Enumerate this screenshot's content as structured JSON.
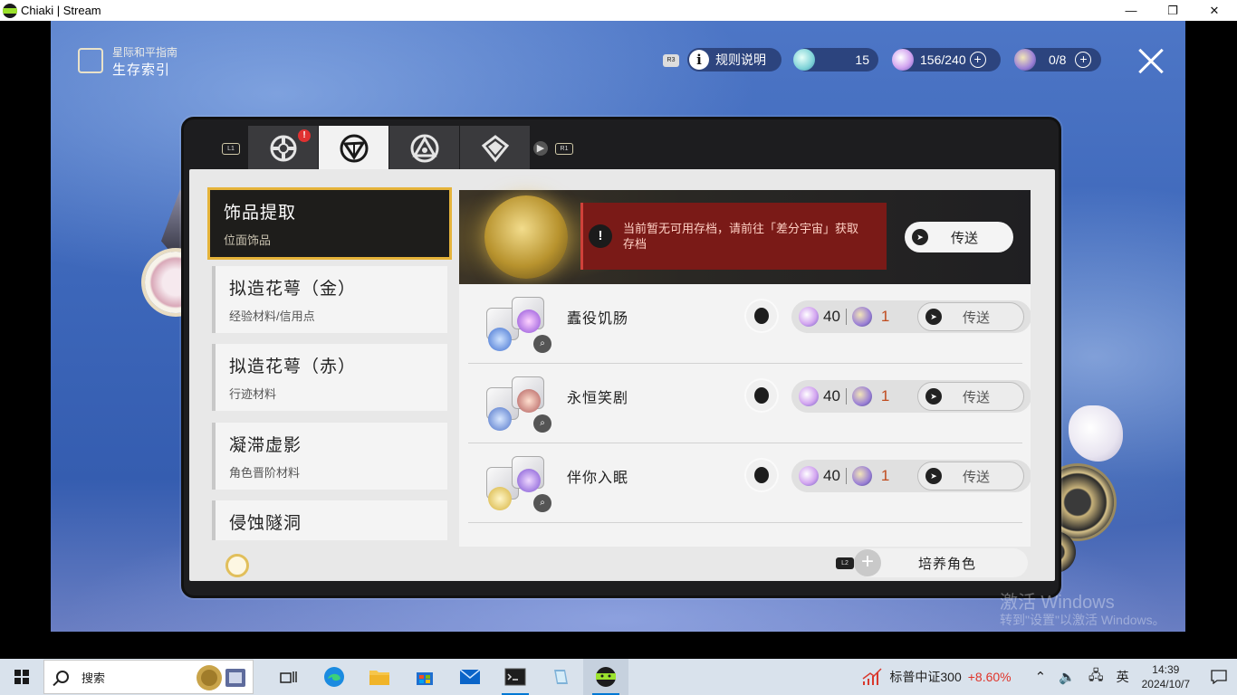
{
  "window": {
    "title": "Chiaki | Stream",
    "controls": {
      "minimize": "—",
      "maximize": "❐",
      "close": "✕"
    }
  },
  "header": {
    "subtitle": "星际和平指南",
    "title": "生存索引",
    "r3_hint": "R3",
    "rules_label": "规则说明",
    "currency_1": "15",
    "currency_2": "156/240",
    "currency_3": "0/8"
  },
  "tabs": {
    "l1_hint": "L1",
    "r1_hint": "R1",
    "badge": "!",
    "items": [
      {
        "name": "tab-1",
        "active": false
      },
      {
        "name": "tab-2",
        "active": true
      },
      {
        "name": "tab-3",
        "active": false
      },
      {
        "name": "tab-4",
        "active": false
      }
    ]
  },
  "sidebar": {
    "items": [
      {
        "title": "饰品提取",
        "subtitle": "位面饰品"
      },
      {
        "title": "拟造花萼（金）",
        "subtitle": "经验材料/信用点"
      },
      {
        "title": "拟造花萼（赤）",
        "subtitle": "行迹材料"
      },
      {
        "title": "凝滞虚影",
        "subtitle": "角色晋阶材料"
      },
      {
        "title": "侵蚀隧洞",
        "subtitle": ""
      }
    ]
  },
  "banner": {
    "warning": "当前暂无可用存档，请前往「差分宇宙」获取存档",
    "teleport_label": "传送"
  },
  "list": {
    "rows": [
      {
        "name": "蠹役饥肠",
        "cost_1": "40",
        "cost_2": "1",
        "teleport": "传送"
      },
      {
        "name": "永恒笑剧",
        "cost_1": "40",
        "cost_2": "1",
        "teleport": "传送"
      },
      {
        "name": "伴你入眠",
        "cost_1": "40",
        "cost_2": "1",
        "teleport": "传送"
      }
    ]
  },
  "footer": {
    "l2_hint": "L2",
    "cultivate_label": "培养角色"
  },
  "watermark": {
    "line1": "激活 Windows",
    "line2": "转到\"设置\"以激活 Windows。"
  },
  "taskbar": {
    "search_placeholder": "搜索",
    "stock_label": "标普中证300",
    "stock_change": "+8.60%",
    "ime": "英",
    "time": "14:39",
    "date": "2024/10/7"
  },
  "colors": {
    "accent_gold": "#e5b33a",
    "warning_red": "#7a1a17",
    "stock_red": "#e0342a"
  }
}
